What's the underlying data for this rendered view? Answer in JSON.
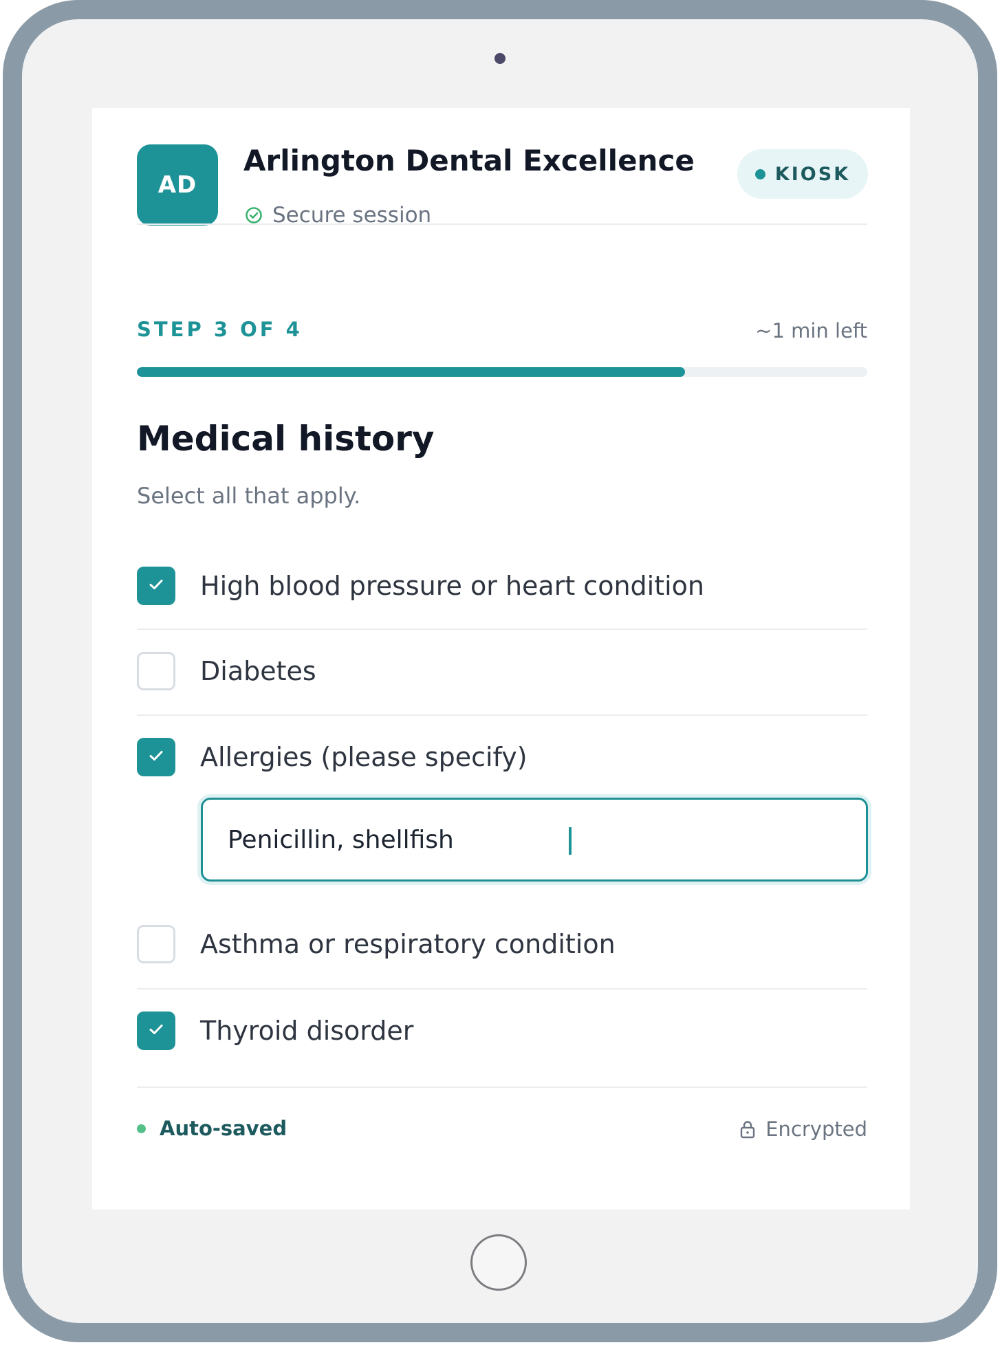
{
  "header": {
    "logo_initials": "AD",
    "clinic_name": "Arlington Dental Excellence",
    "session_status": "Secure session",
    "mode_badge": "KIOSK"
  },
  "progress": {
    "step_label": "STEP 3 OF 4",
    "time_left": "~1 min left",
    "fraction": 0.75
  },
  "section": {
    "title": "Medical history",
    "subtitle": "Select all that apply."
  },
  "options": [
    {
      "label": "High blood pressure or heart condition",
      "checked": true
    },
    {
      "label": "Diabetes",
      "checked": false
    },
    {
      "label": "Allergies (please specify)",
      "checked": true
    },
    {
      "label": "Asthma or respiratory condition",
      "checked": false
    },
    {
      "label": "Thyroid disorder",
      "checked": true
    }
  ],
  "allergy_input": {
    "value": "Penicillin, shellfish"
  },
  "footer": {
    "autosave_status": "Auto-saved",
    "security_label": "Encrypted"
  },
  "icons": {
    "secure": "check-circle-icon",
    "lock": "lock-icon",
    "checkbox_check": "checkmark-icon"
  },
  "colors": {
    "accent": "#1e9397",
    "autosave_dot": "#54c089",
    "device_frame": "#8a9aa6"
  }
}
